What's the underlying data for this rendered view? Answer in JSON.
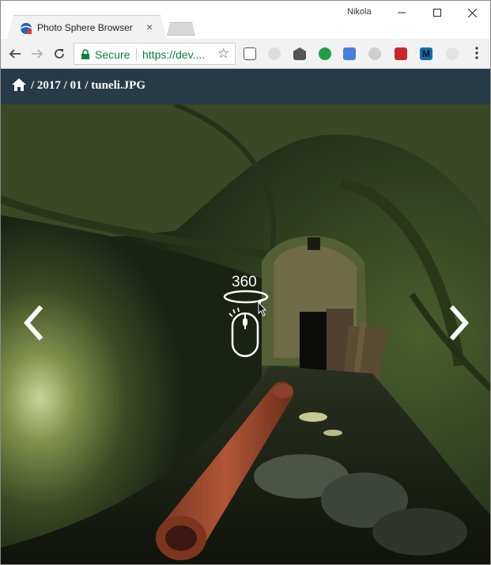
{
  "browser": {
    "tab_title": "Photo Sphere Browser",
    "tab_close": "×",
    "profile_name": "Nikola",
    "security_label": "Secure",
    "url_text": "https://dev....",
    "controls": {
      "minimize": "—",
      "maximize": "☐",
      "close": "✕"
    }
  },
  "header": {
    "breadcrumb": "/ 2017 / 01 / tuneli.JPG"
  },
  "viewer": {
    "hint_text": "360"
  },
  "colors": {
    "header_bg": "#263a47",
    "secure_green": "#0b8043"
  },
  "icons": [
    "back-icon",
    "forward-icon",
    "reload-icon",
    "lock-icon",
    "star-icon",
    "home-icon",
    "prev-arrow-icon",
    "next-arrow-icon",
    "mouse-drag-icon"
  ]
}
